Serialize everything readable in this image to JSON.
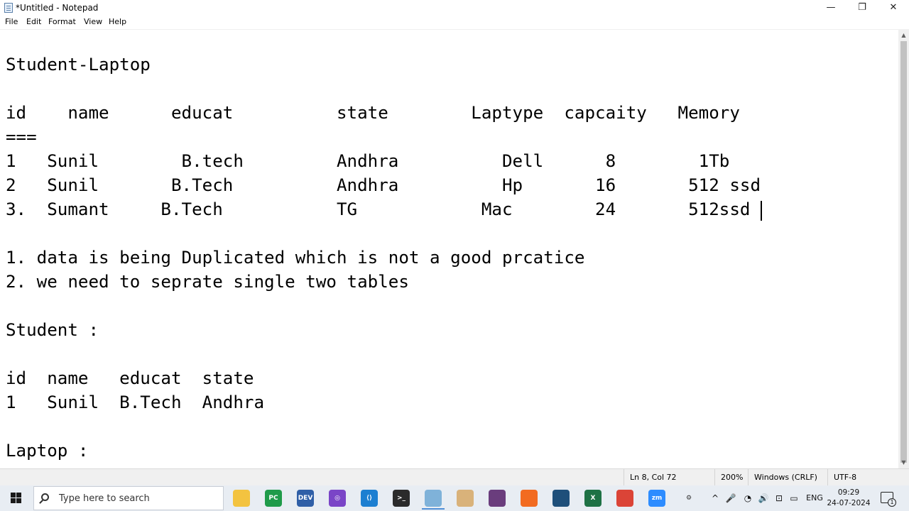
{
  "window": {
    "title": "*Untitled - Notepad",
    "minimize_glyph": "—",
    "maximize_glyph": "❐",
    "close_glyph": "✕"
  },
  "menu": [
    "File",
    "Edit",
    "Format",
    "View",
    "Help"
  ],
  "editor": {
    "lines": [
      "",
      "Student-Laptop",
      "",
      "id    name      educat          state        Laptype  capcaity   Memory",
      "===",
      "1   Sunil        B.tech         Andhra          Dell      8        1Tb",
      "2   Sunil       B.Tech          Andhra          Hp       16       512 ssd",
      "3.  Sumant     B.Tech           TG            Mac        24       512ssd",
      "",
      "1. data is being Duplicated which is not a good prcatice",
      "2. we need to seprate single two tables",
      "",
      "Student :",
      "",
      "id  name   educat  state",
      "1   Sunil  B.Tech  Andhra",
      "",
      "Laptop :"
    ]
  },
  "statusbar": {
    "position": "Ln 8, Col 72",
    "zoom": "200%",
    "line_ending": "Windows (CRLF)",
    "encoding": "UTF-8"
  },
  "taskbar": {
    "search_placeholder": "Type here to search",
    "apps": [
      {
        "name": "file-explorer",
        "label": "",
        "color": "#f3c340"
      },
      {
        "name": "pycharm",
        "label": "PC",
        "color": "#1f9b4a"
      },
      {
        "name": "dev-app",
        "label": "DEV",
        "color": "#2f5fa7"
      },
      {
        "name": "github-desktop",
        "label": "◎",
        "color": "#7a45c7"
      },
      {
        "name": "vscode",
        "label": "⟨⟩",
        "color": "#1d7fd1"
      },
      {
        "name": "terminal",
        "label": ">_",
        "color": "#2b2b2b"
      },
      {
        "name": "notepad",
        "label": "",
        "color": "#7fb2d9"
      },
      {
        "name": "paint",
        "label": "",
        "color": "#d9b27a"
      },
      {
        "name": "winrar",
        "label": "",
        "color": "#6a3d7d"
      },
      {
        "name": "postman",
        "label": "",
        "color": "#f26b21"
      },
      {
        "name": "mysql-workbench",
        "label": "",
        "color": "#1e4f7a"
      },
      {
        "name": "excel",
        "label": "X",
        "color": "#1e7145"
      },
      {
        "name": "chrome",
        "label": "",
        "color": "#db4437"
      },
      {
        "name": "zoom",
        "label": "zm",
        "color": "#2d8cff"
      },
      {
        "name": "settings",
        "label": "⚙",
        "color": "#e8edf3"
      }
    ],
    "tray": {
      "chevron": "^",
      "mic": "🎤",
      "wifi": "◔",
      "volume": "🔊",
      "battery": "▭",
      "language": "ENG"
    },
    "time": "09:29",
    "date": "24-07-2024",
    "notification_count": "1"
  }
}
